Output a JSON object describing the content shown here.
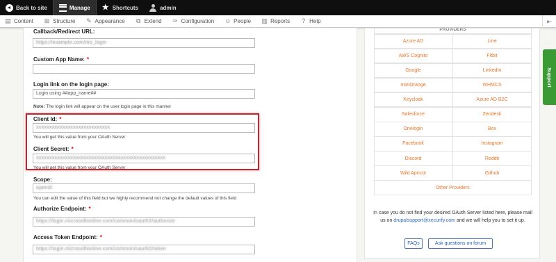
{
  "toolbar": {
    "back": "Back to site",
    "manage": "Manage",
    "shortcuts": "Shortcuts",
    "user": "admin"
  },
  "admin_menu": {
    "items": [
      {
        "label": "Content",
        "icon": "content-icon"
      },
      {
        "label": "Structure",
        "icon": "structure-icon"
      },
      {
        "label": "Appearance",
        "icon": "appearance-icon"
      },
      {
        "label": "Extend",
        "icon": "extend-icon"
      },
      {
        "label": "Configuration",
        "icon": "configuration-icon"
      },
      {
        "label": "People",
        "icon": "people-icon"
      },
      {
        "label": "Reports",
        "icon": "reports-icon"
      },
      {
        "label": "Help",
        "icon": "help-icon"
      }
    ]
  },
  "form": {
    "callback_label": "Callback/Redirect URL:",
    "callback_value": "https://example.com/mo_login",
    "custom_app_name_label": "Custom App Name:",
    "custom_app_name_value": "",
    "login_link_label": "Login link on the login page:",
    "login_link_value": "Login using ##app_name##",
    "login_link_note_bold": "Note:",
    "login_link_note": "The login link will appear on the user login page in this manner",
    "client_id_label": "Client Id:",
    "client_id_value": "xxxxxxxxxxxxxxxxxxxxxxxxxxxx",
    "client_id_desc": "You will get this value from your OAuth Server",
    "client_secret_label": "Client Secret:",
    "client_secret_value": "xxxxxxxxxxxxxxxxxxxxxxxxxxxxxxxxxxxxxxxxxxxxxxxxx",
    "client_secret_desc": "You will get this value from your OAuth Server",
    "scope_label": "Scope:",
    "scope_value": "openid",
    "scope_desc": "You can edit the value of this field but we highly recommend not change the default values of this field",
    "authorize_label": "Authorize Endpoint:",
    "authorize_value": "https://login.microsoftonline.com/common/oauth2/authorize",
    "token_label": "Access Token Endpoint:",
    "token_value": "https://login.microsoftonline.com/common/oauth2/token"
  },
  "providers": {
    "heading": "PROVIDERS",
    "left": [
      "Azure AD",
      "AWS Cognito",
      "Google",
      "miniOrange",
      "Keycloak",
      "Salesforce",
      "Onelogin",
      "Facebook",
      "Discord",
      "Wild Apricot"
    ],
    "right": [
      "Line",
      "Fitbit",
      "LinkedIn",
      "WHMCS",
      "Azure AD B2C",
      "Zendesk",
      "Box",
      "Instagram",
      "Reddit",
      "Github"
    ],
    "other": "Other Providers"
  },
  "help": {
    "text_before": "In case you do not find your desired OAuth Server listed here, please mail us on",
    "email": "drupalsupport@xecurify.com",
    "text_after": "and we will help you to set it up.",
    "faq_button": "FAQs",
    "forum_button": "Ask questions on forum"
  },
  "support_tab": "Support",
  "colors": {
    "provider_link": "#e8762b",
    "highlight": "#c0262d",
    "support": "#3a9a34",
    "required": "#ee0000"
  }
}
